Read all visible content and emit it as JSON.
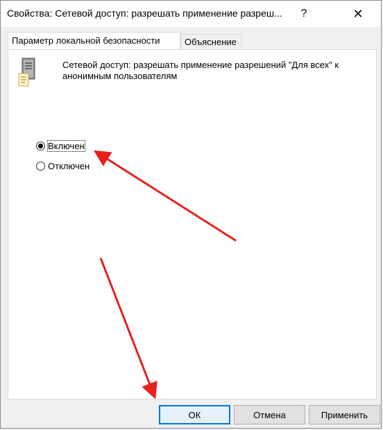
{
  "window": {
    "title": "Свойства: Сетевой доступ: разрешать применение разреш...",
    "help_label": "?",
    "close_label": "✕"
  },
  "tabs": [
    {
      "label": "Параметр локальной безопасности",
      "active": true
    },
    {
      "label": "Объяснение",
      "active": false
    }
  ],
  "policy": {
    "icon": "server-policy-icon",
    "description": "Сетевой доступ: разрешать применение разрешений \"Для всех\" к анонимным пользователям"
  },
  "options": [
    {
      "label": "Включен",
      "checked": true
    },
    {
      "label": "Отключен",
      "checked": false
    }
  ],
  "buttons": {
    "ok": "ОК",
    "cancel": "Отмена",
    "apply": "Применить"
  },
  "colors": {
    "annotation_arrow": "#e8201c",
    "default_button_border": "#0078d7"
  }
}
